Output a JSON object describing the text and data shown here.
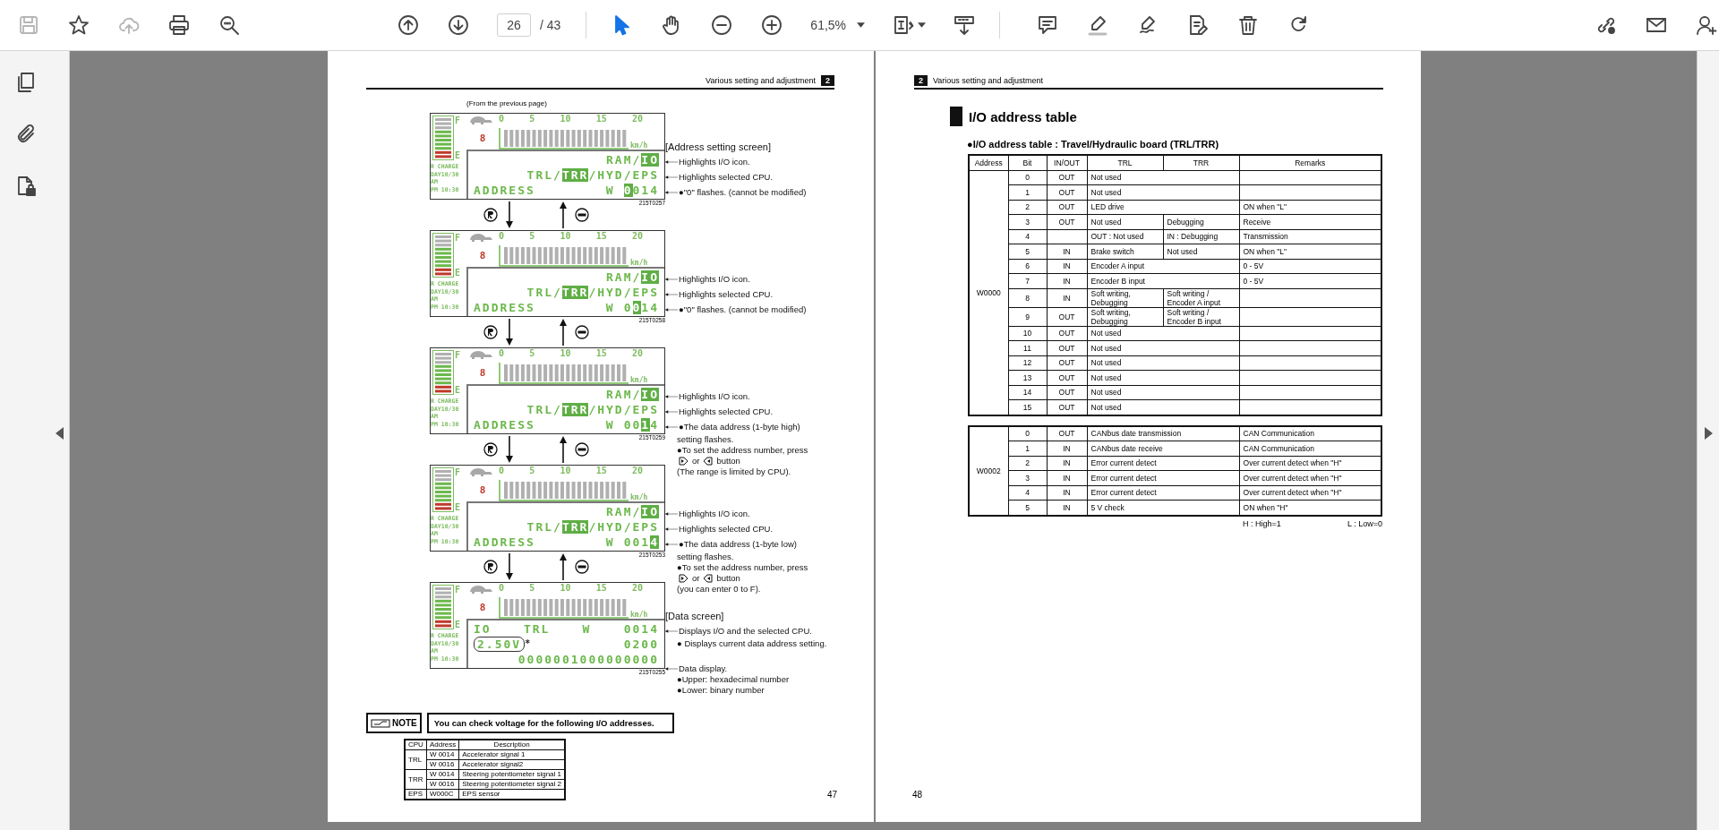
{
  "toolbar": {
    "groups": [
      {
        "items": [
          {
            "kind": "save",
            "disabled": true,
            "selected": false
          },
          {
            "kind": "bookmark",
            "disabled": false,
            "selected": false
          },
          {
            "kind": "upload",
            "disabled": true,
            "selected": false
          },
          {
            "kind": "print",
            "disabled": false,
            "selected": false
          },
          {
            "kind": "search",
            "disabled": false,
            "selected": false
          }
        ]
      },
      {
        "items": [
          {
            "kind": "prev-page",
            "disabled": false,
            "selected": false
          },
          {
            "kind": "next-page",
            "disabled": false,
            "selected": false
          }
        ]
      },
      {
        "items": [
          {
            "kind": "select",
            "disabled": false,
            "selected": true
          },
          {
            "kind": "hand",
            "disabled": false,
            "selected": false
          },
          {
            "kind": "zoom-out",
            "disabled": false,
            "selected": false
          },
          {
            "kind": "zoom-in",
            "disabled": false,
            "selected": false
          }
        ]
      },
      {
        "items": [
          {
            "kind": "fit-page",
            "disabled": false,
            "selected": false
          },
          {
            "kind": "scroll-mode",
            "disabled": false,
            "selected": false
          }
        ]
      },
      {
        "items": [
          {
            "kind": "comment",
            "disabled": false,
            "selected": false
          },
          {
            "kind": "highlight",
            "disabled": false,
            "selected": false
          },
          {
            "kind": "draw",
            "disabled": false,
            "selected": false
          },
          {
            "kind": "edit",
            "disabled": false,
            "selected": false
          },
          {
            "kind": "delete",
            "disabled": false,
            "selected": false
          },
          {
            "kind": "rotate",
            "disabled": false,
            "selected": false
          }
        ]
      },
      {
        "items": [
          {
            "kind": "share",
            "disabled": false,
            "selected": false
          },
          {
            "kind": "email",
            "disabled": false,
            "selected": false
          },
          {
            "kind": "add-user",
            "disabled": false,
            "selected": false
          }
        ]
      }
    ],
    "page": {
      "value": "26",
      "total": "/ 43"
    },
    "zoom": {
      "value": "61,5%"
    }
  },
  "sidebar": {
    "items": [
      {
        "kind": "pages"
      },
      {
        "kind": "attachment"
      },
      {
        "kind": "file-lock"
      }
    ]
  },
  "left_page": {
    "section_title": "Various setting and adjustment",
    "section_number": "2",
    "intro": "(From the previous page)",
    "screens": [
      {
        "heading": "[Address setting screen]",
        "scale": [
          "0",
          "5",
          "10",
          "15",
          "20"
        ],
        "unit": "km/h",
        "gear": "8",
        "full": "F",
        "empty": "E",
        "side": [
          "R CHARGE",
          "DAY10/30",
          "AM",
          "PM 10:30"
        ],
        "figure": "215T0257",
        "lines": [
          {
            "kind": "right",
            "groups": [
              [
                {
                  "t": "RAM/",
                  "kind": "plain"
                },
                {
                  "t": "IO",
                  "kind": "highlight"
                }
              ]
            ]
          },
          {
            "kind": "right",
            "groups": [
              [
                {
                  "t": "TRL/",
                  "kind": "plain"
                },
                {
                  "t": "TRR",
                  "kind": "highlight"
                },
                {
                  "t": "/HYD/EPS",
                  "kind": "plain"
                }
              ]
            ]
          },
          {
            "kind": "split",
            "groups": [
              [
                {
                  "t": "ADDRESS",
                  "kind": "plain"
                }
              ],
              [
                {
                  "t": "W",
                  "kind": "plain"
                }
              ],
              [
                {
                  "t": "0",
                  "kind": "highlight"
                },
                {
                  "t": "014",
                  "kind": "plain"
                }
              ]
            ]
          }
        ],
        "annotations": [
          {
            "kind": "pointer",
            "text": "Highlights I/O icon."
          },
          {
            "kind": "pointer",
            "text": "Highlights selected CPU."
          },
          {
            "kind": "pointer",
            "text": "●\"0\" flashes. (cannot be modified)"
          }
        ]
      },
      {
        "scale": [
          "0",
          "5",
          "10",
          "15",
          "20"
        ],
        "unit": "km/h",
        "gear": "8",
        "full": "F",
        "empty": "E",
        "side": [
          "R CHARGE",
          "DAY10/30",
          "AM",
          "PM 10:30"
        ],
        "figure": "215T0258",
        "lines": [
          {
            "kind": "right",
            "groups": [
              [
                {
                  "t": "RAM/",
                  "kind": "plain"
                },
                {
                  "t": "IO",
                  "kind": "highlight"
                }
              ]
            ]
          },
          {
            "kind": "right",
            "groups": [
              [
                {
                  "t": "TRL/",
                  "kind": "plain"
                },
                {
                  "t": "TRR",
                  "kind": "highlight"
                },
                {
                  "t": "/HYD/EPS",
                  "kind": "plain"
                }
              ]
            ]
          },
          {
            "kind": "split",
            "groups": [
              [
                {
                  "t": "ADDRESS",
                  "kind": "plain"
                }
              ],
              [
                {
                  "t": "W",
                  "kind": "plain"
                }
              ],
              [
                {
                  "t": "0",
                  "kind": "plain"
                },
                {
                  "t": "0",
                  "kind": "highlight"
                },
                {
                  "t": "14",
                  "kind": "plain"
                }
              ]
            ]
          }
        ],
        "annotations": [
          {
            "kind": "pointer",
            "text": "Highlights I/O icon."
          },
          {
            "kind": "pointer",
            "text": "Highlights selected CPU."
          },
          {
            "kind": "pointer",
            "text": "●\"0\" flashes. (cannot be modified)"
          }
        ]
      },
      {
        "scale": [
          "0",
          "5",
          "10",
          "15",
          "20"
        ],
        "unit": "km/h",
        "gear": "8",
        "full": "F",
        "empty": "E",
        "side": [
          "R CHARGE",
          "DAY10/30",
          "AM",
          "PM 10:30"
        ],
        "figure": "215T0259",
        "lines": [
          {
            "kind": "right",
            "groups": [
              [
                {
                  "t": "RAM/",
                  "kind": "plain"
                },
                {
                  "t": "IO",
                  "kind": "highlight"
                }
              ]
            ]
          },
          {
            "kind": "right",
            "groups": [
              [
                {
                  "t": "TRL/",
                  "kind": "plain"
                },
                {
                  "t": "TRR",
                  "kind": "highlight"
                },
                {
                  "t": "/HYD/EPS",
                  "kind": "plain"
                }
              ]
            ]
          },
          {
            "kind": "split",
            "groups": [
              [
                {
                  "t": "ADDRESS",
                  "kind": "plain"
                }
              ],
              [
                {
                  "t": "W",
                  "kind": "plain"
                }
              ],
              [
                {
                  "t": "00",
                  "kind": "plain"
                },
                {
                  "t": "1",
                  "kind": "highlight"
                },
                {
                  "t": "4",
                  "kind": "plain"
                }
              ]
            ]
          }
        ],
        "annotations": [
          {
            "kind": "pointer",
            "text": "Highlights I/O icon."
          },
          {
            "kind": "pointer",
            "text": "Highlights selected CPU."
          },
          {
            "kind": "pointer",
            "text": "●The data address (1-byte high)"
          },
          {
            "kind": "cont",
            "text": "setting flashes."
          },
          {
            "kind": "text",
            "text": "●To set the address number, press"
          },
          {
            "kind": "keys",
            "or": "or",
            "after": "button"
          },
          {
            "kind": "cont",
            "text": "(The range is limited by CPU)."
          }
        ]
      },
      {
        "scale": [
          "0",
          "5",
          "10",
          "15",
          "20"
        ],
        "unit": "km/h",
        "gear": "8",
        "full": "F",
        "empty": "E",
        "side": [
          "R CHARGE",
          "DAY10/30",
          "AM",
          "PM 10:30"
        ],
        "figure": "215T0253",
        "lines": [
          {
            "kind": "right",
            "groups": [
              [
                {
                  "t": "RAM/",
                  "kind": "plain"
                },
                {
                  "t": "IO",
                  "kind": "highlight"
                }
              ]
            ]
          },
          {
            "kind": "right",
            "groups": [
              [
                {
                  "t": "TRL/",
                  "kind": "plain"
                },
                {
                  "t": "TRR",
                  "kind": "highlight"
                },
                {
                  "t": "/HYD/EPS",
                  "kind": "plain"
                }
              ]
            ]
          },
          {
            "kind": "split",
            "groups": [
              [
                {
                  "t": "ADDRESS",
                  "kind": "plain"
                }
              ],
              [
                {
                  "t": "W",
                  "kind": "plain"
                }
              ],
              [
                {
                  "t": "001",
                  "kind": "plain"
                },
                {
                  "t": "4",
                  "kind": "highlight"
                }
              ]
            ]
          }
        ],
        "annotations": [
          {
            "kind": "pointer",
            "text": "Highlights I/O icon."
          },
          {
            "kind": "pointer",
            "text": "Highlights selected CPU."
          },
          {
            "kind": "pointer",
            "text": "●The data address (1-byte low)"
          },
          {
            "kind": "cont",
            "text": "setting flashes."
          },
          {
            "kind": "text",
            "text": "●To set the address number, press"
          },
          {
            "kind": "keys",
            "or": "or",
            "after": "button"
          },
          {
            "kind": "cont",
            "text": "(you can enter 0 to F)."
          }
        ]
      },
      {
        "heading": "[Data screen]",
        "scale": [
          "0",
          "5",
          "10",
          "15",
          "20"
        ],
        "unit": "km/h",
        "gear": "8",
        "full": "F",
        "empty": "E",
        "side": [
          "R CHARGE",
          "DAY10/30",
          "AM",
          "PM 10:30"
        ],
        "figure": "215T0255",
        "lines": [
          {
            "kind": "spread",
            "groups": [
              [
                {
                  "t": "IO",
                  "kind": "plain"
                }
              ],
              [
                {
                  "t": "TRL",
                  "kind": "plain"
                }
              ],
              [
                {
                  "t": "W",
                  "kind": "plain"
                }
              ],
              [
                {
                  "t": "0014",
                  "kind": "plain"
                }
              ]
            ]
          },
          {
            "kind": "split",
            "groups": [
              [
                {
                  "t": "2.50V",
                  "kind": "outline"
                },
                {
                  "t": "*",
                  "kind": "mark"
                }
              ],
              [
                {
                  "t": "0200",
                  "kind": "plain"
                }
              ]
            ]
          },
          {
            "kind": "right",
            "groups": [
              [
                {
                  "t": "0000001000000000",
                  "kind": "plain"
                }
              ]
            ]
          }
        ],
        "annotations": [
          {
            "kind": "pointer",
            "text": "Displays I/O and the selected CPU."
          },
          {
            "kind": "cont",
            "text": "● Displays current data address setting."
          },
          {
            "kind": "bracket",
            "text": "Data display."
          },
          {
            "kind": "cont",
            "text": "●Upper: hexadecimal number"
          },
          {
            "kind": "cont",
            "text": "●Lower: binary number"
          }
        ]
      }
    ],
    "note": {
      "label": "NOTE",
      "text": "You can check voltage for the following I/O addresses."
    },
    "voltage_table": {
      "columns": [
        "CPU",
        "Address",
        "Description"
      ],
      "groups": [
        {
          "cpu": "TRL",
          "rows": [
            {
              "address": "W 0014",
              "description": "Accelerator signal 1"
            },
            {
              "address": "W 0016",
              "description": "Accelerator signal2"
            }
          ]
        },
        {
          "cpu": "TRR",
          "rows": [
            {
              "address": "W 0014",
              "description": "Steering potentiometer signal 1"
            },
            {
              "address": "W 0016",
              "description": "Steering potentiometer signal 2"
            }
          ]
        },
        {
          "cpu": "EPS",
          "rows": [
            {
              "address": "W000C",
              "description": "EPS sensor"
            }
          ]
        }
      ]
    },
    "page_number": "47"
  },
  "right_page": {
    "section_number": "2",
    "section_title": "Various setting and adjustment",
    "title": "I/O address table",
    "subtitle": "●I/O address table : Travel/Hydraulic board (TRL/TRR)",
    "tables": [
      {
        "columns": [
          "Address",
          "Bit",
          "IN/OUT",
          "TRL",
          "TRR",
          "Remarks"
        ],
        "address": "W0000",
        "rows": [
          {
            "bit": "0",
            "io": "OUT",
            "trl": "Not used"
          },
          {
            "bit": "1",
            "io": "OUT",
            "trl": "Not used"
          },
          {
            "bit": "2",
            "io": "OUT",
            "trl": "LED drive",
            "remarks": "ON when \"L\""
          },
          {
            "bit": "3",
            "io": "OUT",
            "trl": "Not used",
            "trr": "Debugging",
            "remarks": "Receive"
          },
          {
            "bit": "4",
            "trl": "OUT : Not used",
            "trr": "IN : Debugging",
            "remarks": "Transmission"
          },
          {
            "bit": "5",
            "io": "IN",
            "trl": "Brake switch",
            "trr": "Not used",
            "remarks": "ON when \"L\""
          },
          {
            "bit": "6",
            "io": "IN",
            "trl": "Encoder A input",
            "remarks": "0 - 5V"
          },
          {
            "bit": "7",
            "io": "IN",
            "trl": "Encoder B input",
            "remarks": "0 - 5V"
          },
          {
            "bit": "8",
            "io": "IN",
            "trl": "Soft writing,\nDebugging",
            "trr": "Soft writing /\nEncoder A input"
          },
          {
            "bit": "9",
            "io": "OUT",
            "trl": "Soft writing,\nDebugging",
            "trr": "Soft writing /\nEncoder B input"
          },
          {
            "bit": "10",
            "io": "OUT",
            "trl": "Not used"
          },
          {
            "bit": "11",
            "io": "OUT",
            "trl": "Not used"
          },
          {
            "bit": "12",
            "io": "OUT",
            "trl": "Not used"
          },
          {
            "bit": "13",
            "io": "OUT",
            "trl": "Not used"
          },
          {
            "bit": "14",
            "io": "OUT",
            "trl": "Not used"
          },
          {
            "bit": "15",
            "io": "OUT",
            "trl": "Not used"
          }
        ]
      },
      {
        "address": "W0002",
        "rows": [
          {
            "bit": "0",
            "io": "OUT",
            "trl": "CANbus date transmission",
            "remarks": "CAN Communication"
          },
          {
            "bit": "1",
            "io": "IN",
            "trl": "CANbus date receive",
            "remarks": "CAN Communication"
          },
          {
            "bit": "2",
            "io": "IN",
            "trl": "Error current detect",
            "remarks": "Over current detect when \"H\""
          },
          {
            "bit": "3",
            "io": "IN",
            "trl": "Error current detect",
            "remarks": "Over current detect when \"H\""
          },
          {
            "bit": "4",
            "io": "IN",
            "trl": "Error current detect",
            "remarks": "Over current detect when \"H\""
          },
          {
            "bit": "5",
            "io": "IN",
            "trl": "5 V check",
            "remarks": "ON when \"H\""
          }
        ]
      }
    ],
    "legend": [
      "H : High=1",
      "L : Low=0"
    ],
    "page_number": "48"
  }
}
